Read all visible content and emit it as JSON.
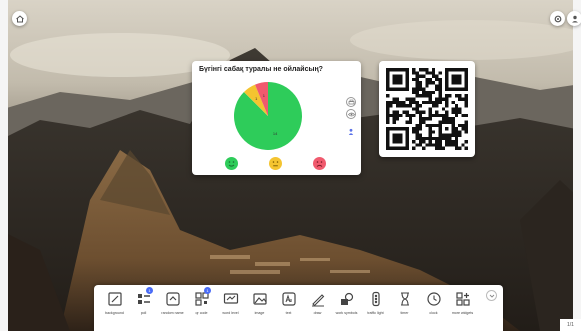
{
  "poll": {
    "question": "Бүгінгі сабақ туралы не ойлайсың?",
    "results": [
      {
        "label": "14",
        "value": 14,
        "color": "#2ecc5a"
      },
      {
        "label": "1",
        "value": 1,
        "color": "#f4c430"
      },
      {
        "label": "1",
        "value": 1,
        "color": "#f05a6e"
      }
    ],
    "reactions": [
      {
        "name": "happy",
        "color": "#2ecc5a"
      },
      {
        "name": "neutral",
        "color": "#f4c430"
      },
      {
        "name": "sad",
        "color": "#f05a6e"
      }
    ]
  },
  "toolbar": {
    "items": [
      {
        "name": "background",
        "label": "background",
        "icon": "background-icon"
      },
      {
        "name": "poll",
        "label": "poll",
        "icon": "poll-icon",
        "badge": "1"
      },
      {
        "name": "random-name",
        "label": "random name",
        "icon": "random-name-icon"
      },
      {
        "name": "qr-code",
        "label": "qr code",
        "icon": "qr-code-icon",
        "badge": "1"
      },
      {
        "name": "word-level",
        "label": "word level",
        "icon": "word-level-icon"
      },
      {
        "name": "image",
        "label": "image",
        "icon": "image-icon"
      },
      {
        "name": "text",
        "label": "text",
        "icon": "text-icon"
      },
      {
        "name": "draw",
        "label": "draw",
        "icon": "draw-icon"
      },
      {
        "name": "work-symbols",
        "label": "work symbols",
        "icon": "work-symbols-icon"
      },
      {
        "name": "traffic-light",
        "label": "traffic light",
        "icon": "traffic-light-icon"
      },
      {
        "name": "timer",
        "label": "timer",
        "icon": "timer-icon"
      },
      {
        "name": "clock",
        "label": "clock",
        "icon": "clock-icon"
      },
      {
        "name": "more-widgets",
        "label": "more widgets",
        "icon": "more-widgets-icon"
      }
    ]
  },
  "pager": {
    "text": "1/1"
  }
}
